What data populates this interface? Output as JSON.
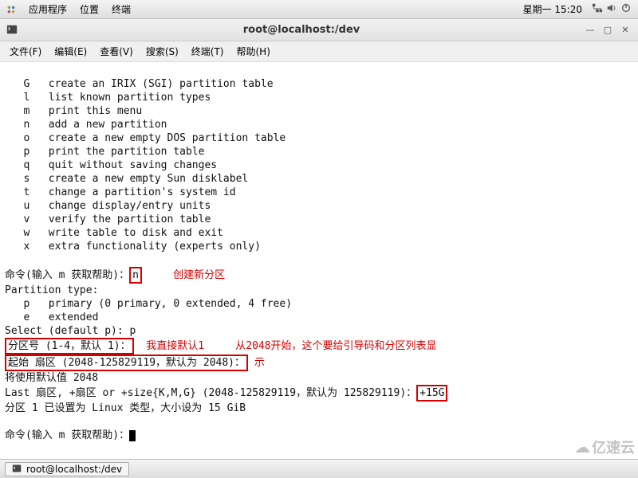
{
  "top_panel": {
    "menus": [
      "应用程序",
      "位置",
      "终端"
    ],
    "clock": "星期一 15:20",
    "sys_icons": [
      "network-icon",
      "volume-icon",
      "power-icon"
    ]
  },
  "window": {
    "title": "root@localhost:/dev",
    "menubar": [
      "文件(F)",
      "编辑(E)",
      "查看(V)",
      "搜索(S)",
      "终端(T)",
      "帮助(H)"
    ],
    "btns": {
      "min": "—",
      "max": "▢",
      "close": "✕"
    }
  },
  "terminal": {
    "help": [
      "   G   create an IRIX (SGI) partition table",
      "   l   list known partition types",
      "   m   print this menu",
      "   n   add a new partition",
      "   o   create a new empty DOS partition table",
      "   p   print the partition table",
      "   q   quit without saving changes",
      "   s   create a new empty Sun disklabel",
      "   t   change a partition's system id",
      "   u   change display/entry units",
      "   v   verify the partition table",
      "   w   write table to disk and exit",
      "   x   extra functionality (experts only)"
    ],
    "cmd_prompt": "命令(输入 m 获取帮助)：",
    "cmd_n": "n",
    "ann_create": "创建新分区",
    "ptype_header": "Partition type:",
    "ptype_p": "   p   primary (0 primary, 0 extended, 4 free)",
    "ptype_e": "   e   extended",
    "select_p": "Select (default p): p",
    "partnum": "分区号 (1-4，默认 1)：",
    "ann_default1": "我直接默认1",
    "ann_from2048": "从2048开始，这个要给引导码和分区列表显",
    "start_sector": "起始 扇区 (2048-125829119，默认为 2048)：",
    "ann_show": "示",
    "use_default": "将使用默认值 2048",
    "last_sector_pre": "Last 扇区, +扇区 or +size{K,M,G} (2048-125829119，默认为 125829119)：",
    "size_input": "+15G",
    "set_result": "分区 1 已设置为 Linux 类型，大小设为 15 GiB",
    "cmd_prompt2": "命令(输入 m 获取帮助)："
  },
  "taskbar": {
    "item": "root@localhost:/dev"
  },
  "watermark": "亿速云",
  "colors": {
    "annotation": "#d40000",
    "background": "#ffffff"
  }
}
